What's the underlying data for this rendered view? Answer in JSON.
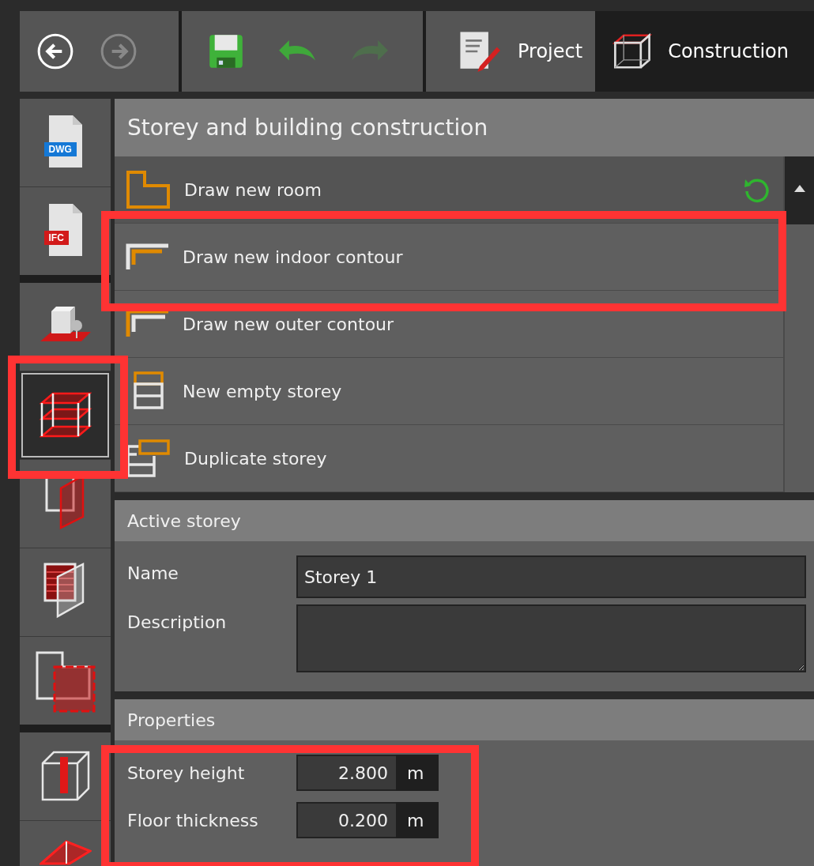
{
  "toolbar": {
    "nav_buttons": [
      {
        "kind": "back",
        "disabled": false
      },
      {
        "kind": "forward",
        "disabled": true
      }
    ],
    "edit_buttons": [
      {
        "kind": "save",
        "disabled": false
      },
      {
        "kind": "undo",
        "disabled": false
      },
      {
        "kind": "redo",
        "disabled": true
      }
    ],
    "tabs": [
      {
        "kind": "project",
        "label": "Project",
        "selected": false
      },
      {
        "kind": "construction",
        "label": "Construction",
        "selected": true
      }
    ]
  },
  "sidebar": {
    "groups": [
      {
        "items": [
          {
            "kind": "dwg",
            "badge": "DWG",
            "selected": false,
            "highlighted": false
          },
          {
            "kind": "ifc",
            "badge": "IFC",
            "selected": false,
            "highlighted": false
          }
        ]
      },
      {
        "items": [
          {
            "kind": "object",
            "selected": false,
            "highlighted": false
          },
          {
            "kind": "storey",
            "selected": true,
            "highlighted": true
          },
          {
            "kind": "wall",
            "selected": false,
            "highlighted": false
          },
          {
            "kind": "hatched-wall",
            "selected": false,
            "highlighted": false
          },
          {
            "kind": "room",
            "selected": false,
            "highlighted": false
          }
        ]
      },
      {
        "items": [
          {
            "kind": "column",
            "selected": false,
            "highlighted": false
          },
          {
            "kind": "roof",
            "selected": false,
            "highlighted": false
          }
        ]
      }
    ]
  },
  "construction_panel": {
    "title": "Storey and building construction",
    "items": [
      {
        "kind": "room",
        "label": "Draw new room",
        "highlighted": false
      },
      {
        "kind": "indoor-contour",
        "label": "Draw new indoor contour",
        "highlighted": true
      },
      {
        "kind": "outer-contour",
        "label": "Draw new outer contour",
        "highlighted": false
      },
      {
        "kind": "new-storey",
        "label": "New empty storey",
        "highlighted": false
      },
      {
        "kind": "duplicate-storey",
        "label": "Duplicate storey",
        "highlighted": false
      }
    ]
  },
  "active_storey": {
    "title": "Active storey",
    "name_label": "Name",
    "name_value": "Storey 1",
    "description_label": "Description"
  },
  "properties": {
    "title": "Properties",
    "highlighted": true,
    "fields": [
      {
        "label": "Storey height",
        "value": "2.800",
        "unit": "m"
      },
      {
        "label": "Floor thickness",
        "value": "0.200",
        "unit": "m"
      }
    ]
  }
}
